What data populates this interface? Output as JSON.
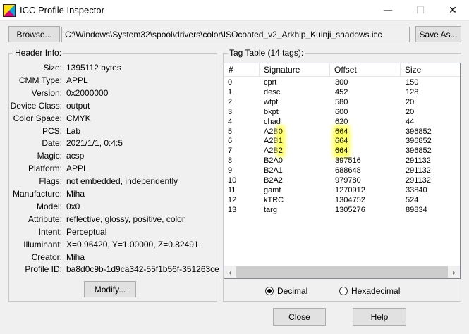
{
  "window": {
    "title": "ICC Profile Inspector",
    "minimize_glyph": "—",
    "maximize_glyph": "☐",
    "close_glyph": "✕"
  },
  "toolbar": {
    "browse_label": "Browse...",
    "path_value": "C:\\Windows\\System32\\spool\\drivers\\color\\ISOcoated_v2_Arkhip_Kuinji_shadows.icc",
    "save_as_label": "Save As..."
  },
  "header": {
    "group_label": "Header Info:",
    "fields": [
      {
        "key": "Size:",
        "value": "1395112 bytes"
      },
      {
        "key": "CMM Type:",
        "value": "APPL"
      },
      {
        "key": "Version:",
        "value": "0x2000000"
      },
      {
        "key": "Device Class:",
        "value": "output"
      },
      {
        "key": "Color Space:",
        "value": "CMYK"
      },
      {
        "key": "PCS:",
        "value": "Lab"
      },
      {
        "key": "Date:",
        "value": "2021/1/1, 0:4:5"
      },
      {
        "key": "Magic:",
        "value": "acsp"
      },
      {
        "key": "Platform:",
        "value": "APPL"
      },
      {
        "key": "Flags:",
        "value": "not embedded, independently"
      },
      {
        "key": "Manufacture:",
        "value": "Miha"
      },
      {
        "key": "Model:",
        "value": "0x0"
      },
      {
        "key": "Attribute:",
        "value": "reflective, glossy, positive, color"
      },
      {
        "key": "Intent:",
        "value": "Perceptual"
      },
      {
        "key": "Illuminant:",
        "value": "X=0.96420, Y=1.00000, Z=0.82491"
      },
      {
        "key": "Creator:",
        "value": "Miha"
      },
      {
        "key": "Profile ID:",
        "value": "ba8d0c9b-1d9ca342-55f1b56f-351263ce"
      }
    ],
    "modify_label": "Modify..."
  },
  "tags": {
    "group_label": "Tag Table (14 tags):",
    "columns": [
      "#",
      "Signature",
      "Offset",
      "Size"
    ],
    "rows": [
      {
        "num": "0",
        "sig": "cprt",
        "offset": "300",
        "size": "150",
        "hl": false
      },
      {
        "num": "1",
        "sig": "desc",
        "offset": "452",
        "size": "128",
        "hl": false
      },
      {
        "num": "2",
        "sig": "wtpt",
        "offset": "580",
        "size": "20",
        "hl": false
      },
      {
        "num": "3",
        "sig": "bkpt",
        "offset": "600",
        "size": "20",
        "hl": false
      },
      {
        "num": "4",
        "sig": "chad",
        "offset": "620",
        "size": "44",
        "hl": false
      },
      {
        "num": "5",
        "sig": "A2B0",
        "offset": "664",
        "size": "396852",
        "hl": true
      },
      {
        "num": "6",
        "sig": "A2B1",
        "offset": "664",
        "size": "396852",
        "hl": true
      },
      {
        "num": "7",
        "sig": "A2B2",
        "offset": "664",
        "size": "396852",
        "hl": true
      },
      {
        "num": "8",
        "sig": "B2A0",
        "offset": "397516",
        "size": "291132",
        "hl": false
      },
      {
        "num": "9",
        "sig": "B2A1",
        "offset": "688648",
        "size": "291132",
        "hl": false
      },
      {
        "num": "10",
        "sig": "B2A2",
        "offset": "979780",
        "size": "291132",
        "hl": false
      },
      {
        "num": "11",
        "sig": "gamt",
        "offset": "1270912",
        "size": "33840",
        "hl": false
      },
      {
        "num": "12",
        "sig": "kTRC",
        "offset": "1304752",
        "size": "524",
        "hl": false
      },
      {
        "num": "13",
        "sig": "targ",
        "offset": "1305276",
        "size": "89834",
        "hl": false
      }
    ],
    "highlight_color": "#ffff66",
    "scroll_left_glyph": "‹",
    "scroll_right_glyph": "›"
  },
  "number_format": {
    "options": [
      {
        "label": "Decimal",
        "selected": true
      },
      {
        "label": "Hexadecimal",
        "selected": false
      }
    ]
  },
  "footer": {
    "close_label": "Close",
    "help_label": "Help"
  }
}
